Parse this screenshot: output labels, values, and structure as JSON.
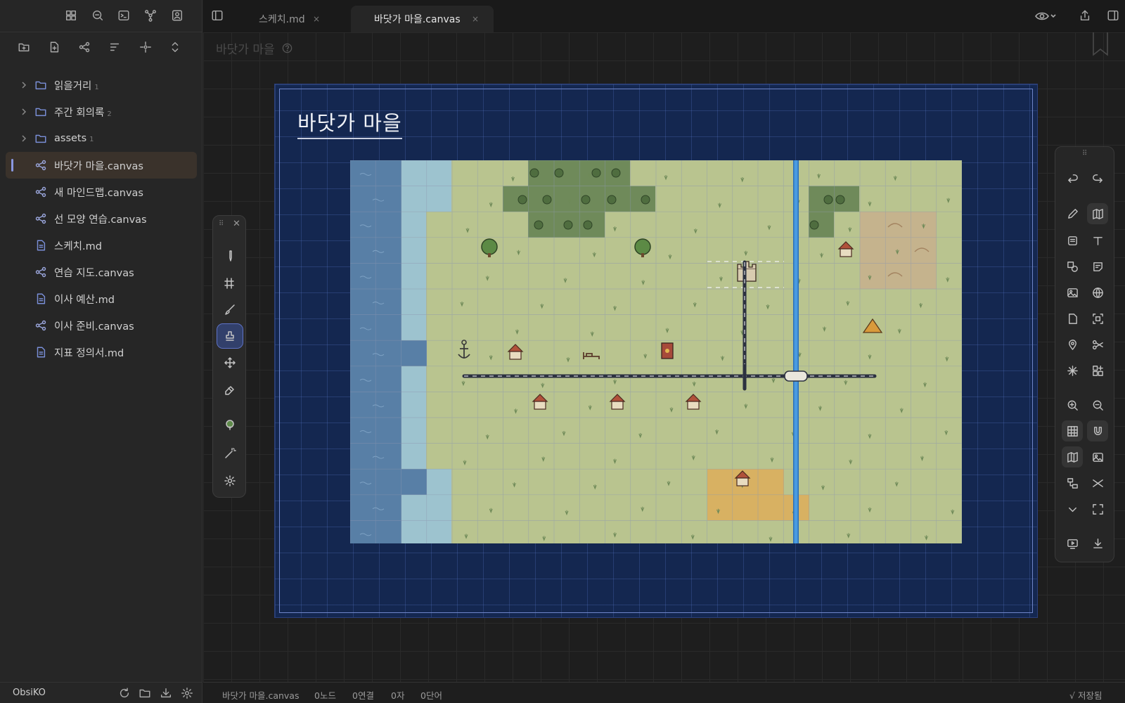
{
  "sidebar": {
    "tree": [
      {
        "type": "folder",
        "label": "읽을거리",
        "count": "1"
      },
      {
        "type": "folder",
        "label": "주간 회의록",
        "count": "2"
      },
      {
        "type": "folder",
        "label": "assets",
        "count": "1"
      },
      {
        "type": "canvas",
        "label": "바닷가 마을.canvas",
        "active": true
      },
      {
        "type": "canvas",
        "label": "새 마인드맵.canvas"
      },
      {
        "type": "canvas",
        "label": "선 모양 연습.canvas"
      },
      {
        "type": "md",
        "label": "스케치.md"
      },
      {
        "type": "canvas",
        "label": "연습 지도.canvas"
      },
      {
        "type": "md",
        "label": "이사 예산.md"
      },
      {
        "type": "canvas",
        "label": "이사 준비.canvas"
      },
      {
        "type": "md",
        "label": "지표 정의서.md"
      }
    ],
    "vault_name": "ObsiKO"
  },
  "tabs": [
    {
      "label": "스케치.md",
      "close": "×",
      "active": false
    },
    {
      "label": "바닷가 마을.canvas",
      "close": "×",
      "active": true
    }
  ],
  "canvas": {
    "inline_title": "바닷가 마을",
    "map_title": "바닷가 마을"
  },
  "statusbar": {
    "file": "바닷가 마을.canvas",
    "nodes": "0노드",
    "links": "0연결",
    "chars": "0자",
    "words": "0단어",
    "saved": "√ 저장됨"
  },
  "colors": {
    "accent": "#8a97e0",
    "map_bg": "#142750",
    "grass": "#b9c48f",
    "deep_water": "#587fa6",
    "shallow_water": "#9dc3cf",
    "forest": "#6f8a5a",
    "river": "#4a9be0",
    "wheat": "#e0ac56",
    "sand": "#c9ae8c"
  }
}
